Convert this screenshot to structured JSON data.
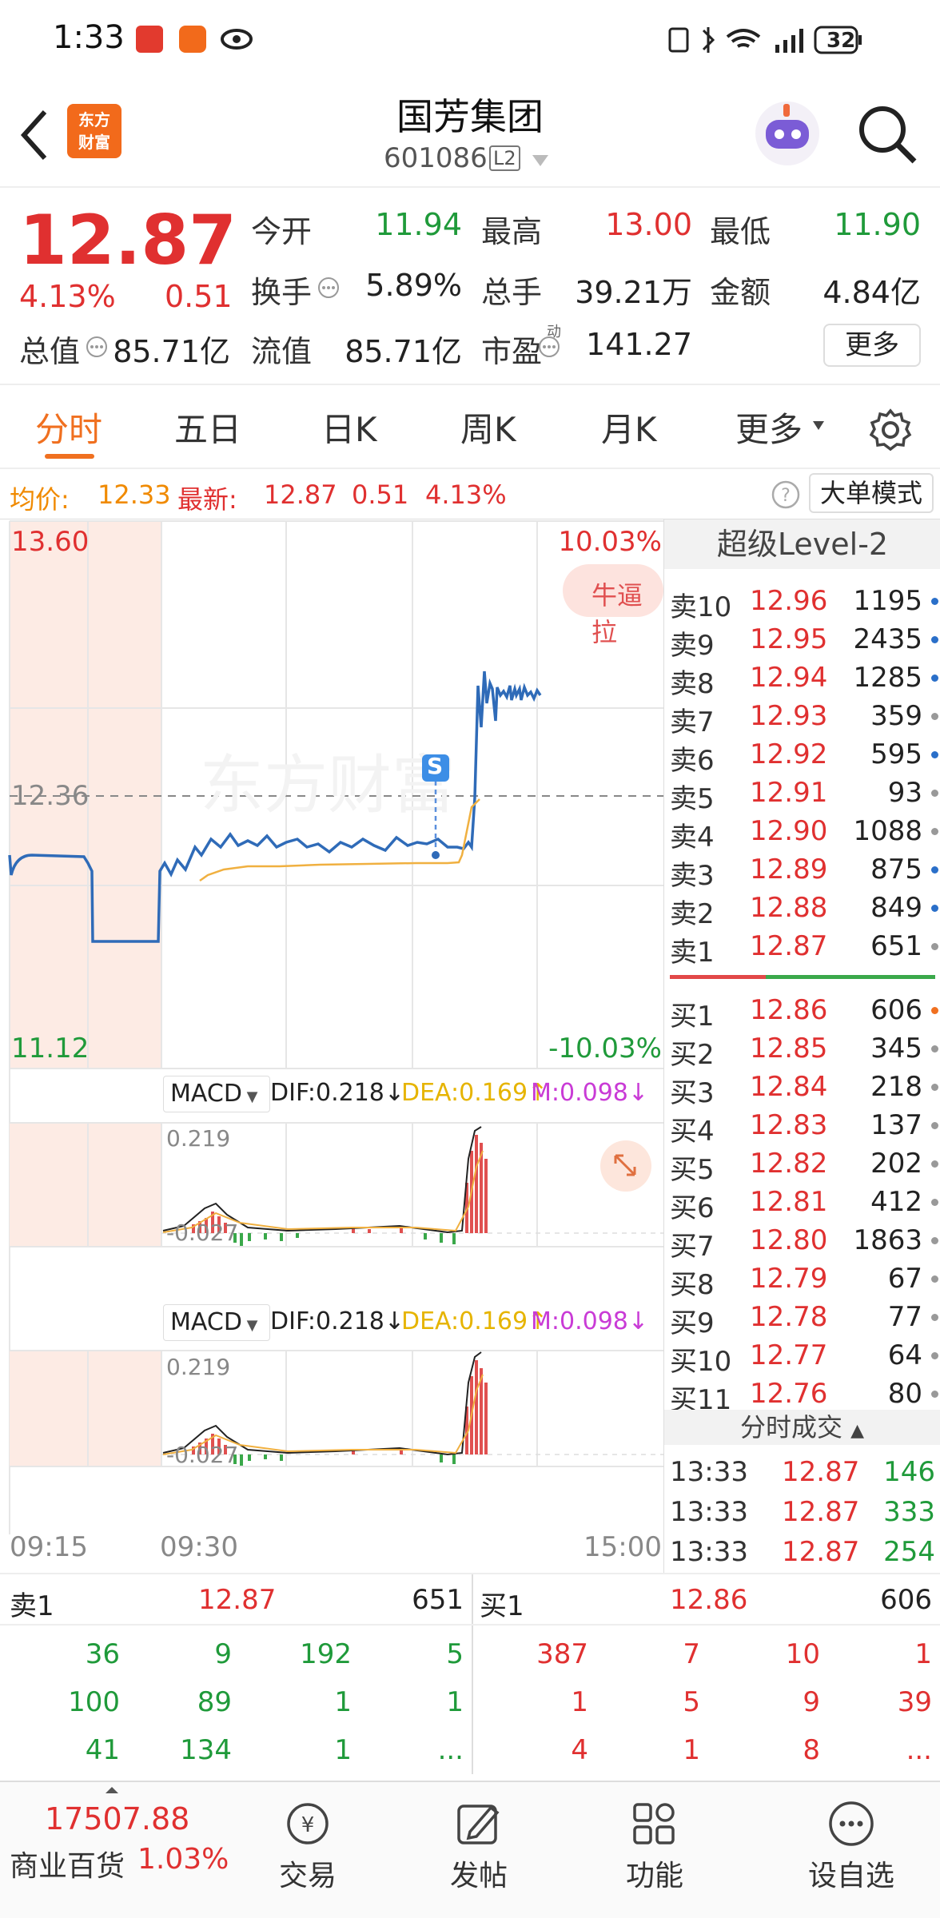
{
  "status_bar": {
    "time": "1:33",
    "battery": "32"
  },
  "header": {
    "back_icon": "chevron-left-icon",
    "logo_text_1": "东方",
    "logo_text_2": "财富",
    "title": "国芳集团",
    "code": "601086",
    "level_badge": "L2"
  },
  "quote": {
    "price": "12.87",
    "change_pct": "4.13%",
    "change": "0.51",
    "open_label": "今开",
    "open": "11.94",
    "high_label": "最高",
    "high": "13.00",
    "low_label": "最低",
    "low": "11.90",
    "turnover_label": "换手",
    "turnover": "5.89%",
    "volume_label": "总手",
    "volume": "39.21万",
    "amount_label": "金额",
    "amount": "4.84亿",
    "mcap_label": "总值",
    "mcap": "85.71亿",
    "float_label": "流值",
    "float": "85.71亿",
    "pe_label": "市盈",
    "pe_sup": "动",
    "pe": "141.27",
    "more_button": "更多"
  },
  "tabs": [
    "分时",
    "五日",
    "日K",
    "周K",
    "月K",
    "更多"
  ],
  "infobar": {
    "avg_label": "均价:",
    "avg": "12.33",
    "latest_label": "最新:",
    "latest": "12.87",
    "change": "0.51",
    "change_pct": "4.13%",
    "mode_button": "大单模式"
  },
  "chart": {
    "y_top": "13.60",
    "y_mid": "12.36",
    "y_bottom": "11.12",
    "pct_top": "10.03%",
    "pct_bottom": "-10.03%",
    "badge": "牛逼拉",
    "watermark": "东方财富",
    "signal": "S",
    "x_labels": [
      "09:15",
      "09:30",
      "15:00"
    ]
  },
  "macd1": {
    "name": "MACD",
    "dif": "DIF:0.218",
    "dea": "DEA:0.169",
    "m": "M:0.098",
    "top": "0.219",
    "bottom": "-0.027"
  },
  "macd2": {
    "name": "MACD",
    "dif": "DIF:0.218",
    "dea": "DEA:0.169",
    "m": "M:0.098",
    "top": "0.219",
    "bottom": "-0.027"
  },
  "level2": {
    "title": "超级Level-2",
    "asks": [
      {
        "k": "卖10",
        "p": "12.96",
        "v": "1195",
        "c": "#2a6fc9"
      },
      {
        "k": "卖9",
        "p": "12.95",
        "v": "2435",
        "c": "#2a6fc9"
      },
      {
        "k": "卖8",
        "p": "12.94",
        "v": "1285",
        "c": "#2a6fc9"
      },
      {
        "k": "卖7",
        "p": "12.93",
        "v": "359",
        "c": "#999999"
      },
      {
        "k": "卖6",
        "p": "12.92",
        "v": "595",
        "c": "#2a6fc9"
      },
      {
        "k": "卖5",
        "p": "12.91",
        "v": "93",
        "c": "#999999"
      },
      {
        "k": "卖4",
        "p": "12.90",
        "v": "1088",
        "c": "#999999"
      },
      {
        "k": "卖3",
        "p": "12.89",
        "v": "875",
        "c": "#2a6fc9"
      },
      {
        "k": "卖2",
        "p": "12.88",
        "v": "849",
        "c": "#2a6fc9"
      },
      {
        "k": "卖1",
        "p": "12.87",
        "v": "651",
        "c": "#999999"
      }
    ],
    "bids": [
      {
        "k": "买1",
        "p": "12.86",
        "v": "606",
        "c": "#f07020"
      },
      {
        "k": "买2",
        "p": "12.85",
        "v": "345",
        "c": "#999999"
      },
      {
        "k": "买3",
        "p": "12.84",
        "v": "218",
        "c": "#999999"
      },
      {
        "k": "买4",
        "p": "12.83",
        "v": "137",
        "c": "#999999"
      },
      {
        "k": "买5",
        "p": "12.82",
        "v": "202",
        "c": "#999999"
      },
      {
        "k": "买6",
        "p": "12.81",
        "v": "412",
        "c": "#999999"
      },
      {
        "k": "买7",
        "p": "12.80",
        "v": "1863",
        "c": "#999999"
      },
      {
        "k": "买8",
        "p": "12.79",
        "v": "67",
        "c": "#999999"
      },
      {
        "k": "买9",
        "p": "12.78",
        "v": "77",
        "c": "#999999"
      },
      {
        "k": "买10",
        "p": "12.77",
        "v": "64",
        "c": "#999999"
      },
      {
        "k": "买11",
        "p": "12.76",
        "v": "80",
        "c": "#999999"
      }
    ],
    "ticks_title": "分时成交",
    "ticks": [
      {
        "t": "13:33",
        "p": "12.87",
        "v": "146"
      },
      {
        "t": "13:33",
        "p": "12.87",
        "v": "333"
      },
      {
        "t": "13:33",
        "p": "12.87",
        "v": "254"
      }
    ]
  },
  "bottom_panel": {
    "sell_label": "卖1",
    "sell_price": "12.87",
    "sell_vol": "651",
    "buy_label": "买1",
    "buy_price": "12.86",
    "buy_vol": "606",
    "sell_rows": [
      [
        "36",
        "9",
        "192",
        "5"
      ],
      [
        "100",
        "89",
        "1",
        "1"
      ],
      [
        "41",
        "134",
        "1",
        "..."
      ]
    ],
    "buy_rows": [
      [
        "387",
        "7",
        "10",
        "1"
      ],
      [
        "1",
        "5",
        "9",
        "39"
      ],
      [
        "4",
        "1",
        "8",
        "..."
      ]
    ]
  },
  "nav": {
    "index_value": "17507.88",
    "index_name": "商业百货",
    "index_change": "1.03%",
    "items": [
      "交易",
      "发帖",
      "功能",
      "设自选"
    ]
  }
}
